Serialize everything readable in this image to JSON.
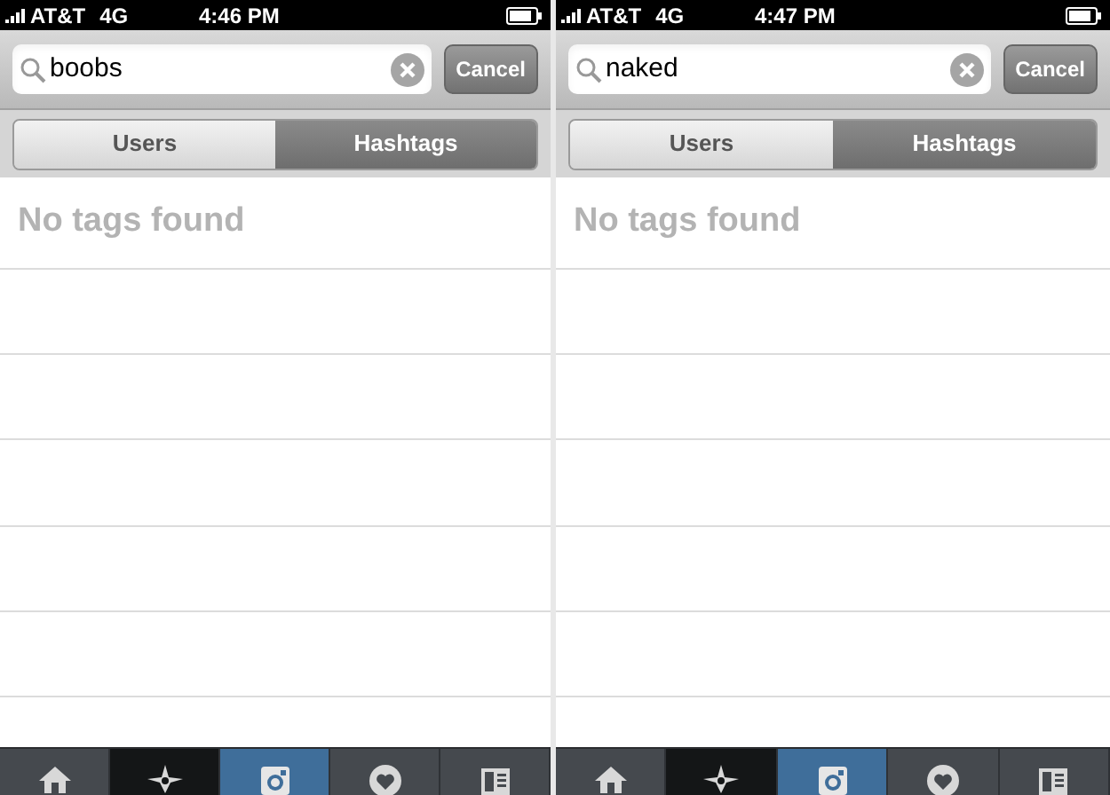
{
  "screens": [
    {
      "status_bar": {
        "carrier": "AT&T",
        "network": "4G",
        "time": "4:46 PM"
      },
      "search": {
        "value": "boobs"
      },
      "cancel_button": "Cancel",
      "segments": [
        {
          "label": "Users",
          "selected": false
        },
        {
          "label": "Hashtags",
          "selected": true
        }
      ],
      "message": "No tags found",
      "tabs": [
        {
          "kind": "home",
          "selected": false
        },
        {
          "kind": "explore",
          "selected": true
        },
        {
          "kind": "camera",
          "selected": false
        },
        {
          "kind": "activity",
          "selected": false
        },
        {
          "kind": "profile",
          "selected": false
        }
      ]
    },
    {
      "status_bar": {
        "carrier": "AT&T",
        "network": "4G",
        "time": "4:47 PM"
      },
      "search": {
        "value": "naked"
      },
      "cancel_button": "Cancel",
      "segments": [
        {
          "label": "Users",
          "selected": false
        },
        {
          "label": "Hashtags",
          "selected": true
        }
      ],
      "message": "No tags found",
      "tabs": [
        {
          "kind": "home",
          "selected": false
        },
        {
          "kind": "explore",
          "selected": true
        },
        {
          "kind": "camera",
          "selected": false
        },
        {
          "kind": "activity",
          "selected": false
        },
        {
          "kind": "profile",
          "selected": false
        }
      ]
    }
  ]
}
